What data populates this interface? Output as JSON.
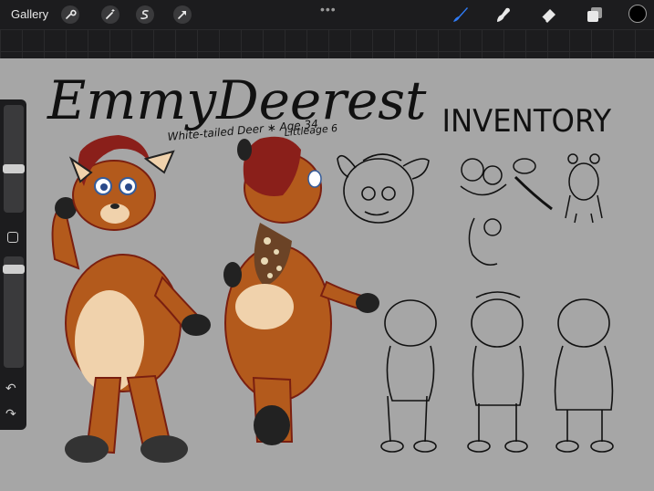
{
  "toolbar": {
    "gallery_label": "Gallery",
    "more_dots": "•••",
    "left_tools": [
      "wrench-icon",
      "magic-wand-icon",
      "selection-s-icon",
      "transform-arrow-icon"
    ],
    "right_tools": [
      "brush-icon",
      "smudge-icon",
      "eraser-icon",
      "layers-icon"
    ],
    "active_color": "#000000",
    "accent": "#2f7bf5"
  },
  "sidebar": {
    "brush_size_level": 0.55,
    "opacity_level": 0.88,
    "undo_label": "↶",
    "redo_label": "↷"
  },
  "artwork": {
    "title": "EmmyDeerest",
    "species_age": "White-tailed Deer ∗ Age 34",
    "littleage": "Littleage 6",
    "inventory_heading": "INVENTORY"
  }
}
